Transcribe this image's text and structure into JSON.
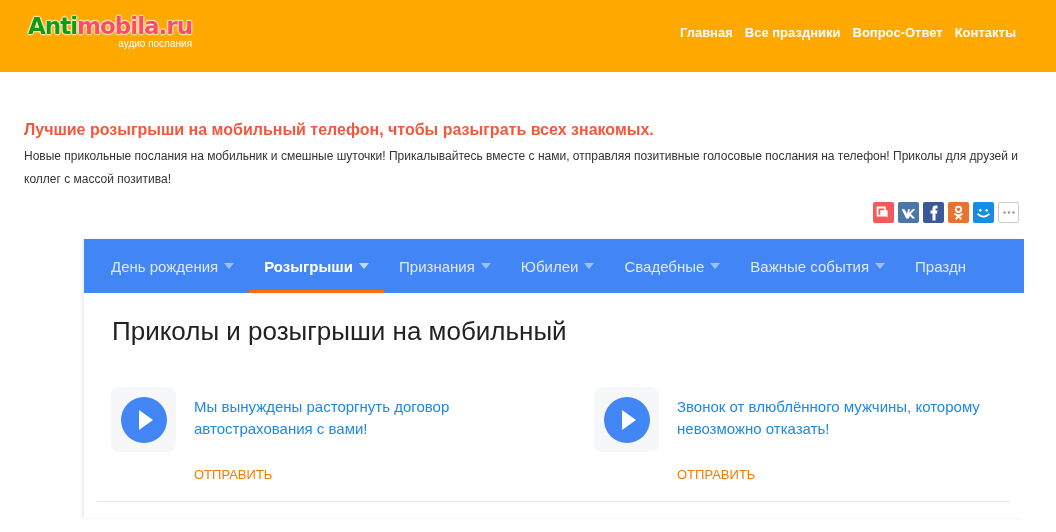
{
  "header": {
    "logo": {
      "lead": "Anti",
      "rest": "mobila.ru",
      "tagline": "аудио послания"
    },
    "nav": [
      {
        "label": "Главная"
      },
      {
        "label": "Все праздники"
      },
      {
        "label": "Вопрос-Ответ"
      },
      {
        "label": "Контакты"
      }
    ]
  },
  "intro": {
    "headline": "Лучшие розыгрыши на мобильный телефон, чтобы разыграть всех знакомых.",
    "text": "Новые прикольные послания на мобильник и смешные шуточки! Прикалывайтесь вместе с нами, отправляя позитивные голосовые послания на телефон! Приколы для друзей и коллег с массой позитива!"
  },
  "share": [
    {
      "kind": "bookmark"
    },
    {
      "kind": "vk"
    },
    {
      "kind": "facebook"
    },
    {
      "kind": "ok"
    },
    {
      "kind": "smile"
    },
    {
      "kind": "more"
    }
  ],
  "tabs": [
    {
      "label": "День рождения",
      "selected": false,
      "dropdown": true
    },
    {
      "label": "Розыгрыши",
      "selected": true,
      "dropdown": true
    },
    {
      "label": "Признания",
      "selected": false,
      "dropdown": true
    },
    {
      "label": "Юбилеи",
      "selected": false,
      "dropdown": true
    },
    {
      "label": "Свадебные",
      "selected": false,
      "dropdown": true
    },
    {
      "label": "Важные события",
      "selected": false,
      "dropdown": true
    },
    {
      "label": "Праздн",
      "selected": false,
      "dropdown": false
    }
  ],
  "section_title": "Приколы и розыгрыши на мобильный",
  "messages": [
    {
      "title": "Мы вынуждены расторгнуть договор автострахования с вами!",
      "action": "ОТПРАВИТЬ"
    },
    {
      "title": "Звонок от влюблённого мужчины, которому невозможно отказать!",
      "action": "ОТПРАВИТЬ"
    }
  ]
}
